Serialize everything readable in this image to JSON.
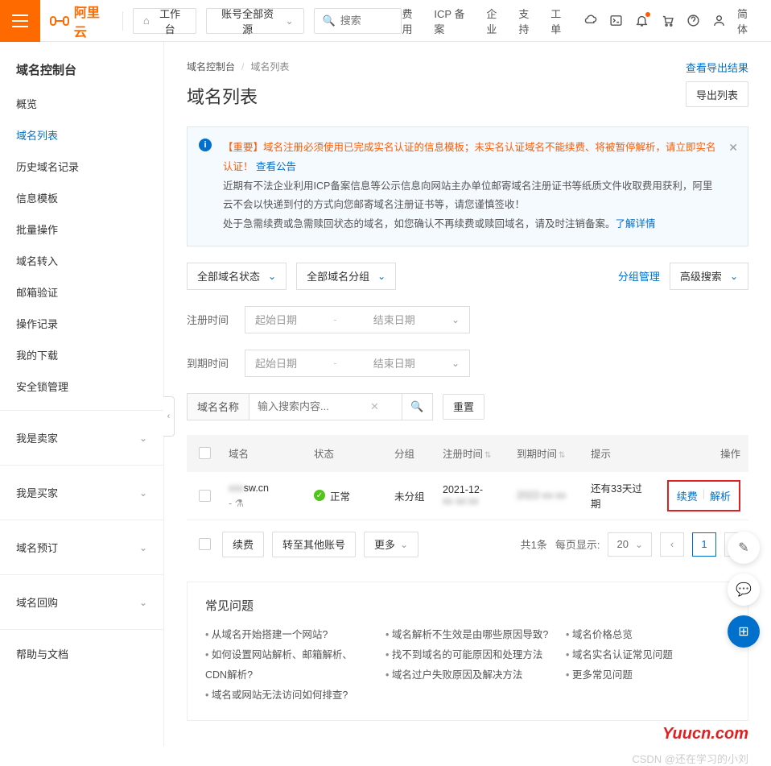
{
  "header": {
    "logo": "阿里云",
    "workspace": "工作台",
    "account_dropdown": "账号全部资源",
    "search_placeholder": "搜索",
    "nav": [
      "费用",
      "ICP 备案",
      "企业",
      "支持",
      "工单"
    ],
    "lang": "简体"
  },
  "sidebar": {
    "title": "域名控制台",
    "items": [
      {
        "label": "概览",
        "active": false
      },
      {
        "label": "域名列表",
        "active": true
      },
      {
        "label": "历史域名记录",
        "active": false
      },
      {
        "label": "信息模板",
        "active": false
      },
      {
        "label": "批量操作",
        "active": false
      },
      {
        "label": "域名转入",
        "active": false
      },
      {
        "label": "邮箱验证",
        "active": false
      },
      {
        "label": "操作记录",
        "active": false
      },
      {
        "label": "我的下载",
        "active": false
      },
      {
        "label": "安全锁管理",
        "active": false
      }
    ],
    "groups": [
      "我是卖家",
      "我是买家",
      "域名预订",
      "域名回购"
    ],
    "help": "帮助与文档"
  },
  "breadcrumb": {
    "parent": "域名控制台",
    "current": "域名列表"
  },
  "page": {
    "title": "域名列表",
    "view_export": "查看导出结果",
    "export_btn": "导出列表"
  },
  "notice": {
    "important_prefix": "【重要】域名注册必须使用已完成实名认证的信息模板；未实名认证域名不能续费、将被暂停解析，请立即实名认证！",
    "link1": "查看公告",
    "line2": "近期有不法企业利用ICP备案信息等公示信息向网站主办单位邮寄域名注册证书等纸质文件收取费用获利，阿里云不会以快递到付的方式向您邮寄域名注册证书等，请您谨慎签收！",
    "line3_prefix": "处于急需续费或急需赎回状态的域名，如您确认不再续费或赎回域名，请及时注销备案。",
    "link2": "了解详情"
  },
  "filters": {
    "status_select": "全部域名状态",
    "group_select": "全部域名分组",
    "group_manage": "分组管理",
    "advanced_search": "高级搜索",
    "reg_time": "注册时间",
    "exp_time": "到期时间",
    "date_start": "起始日期",
    "date_end": "结束日期",
    "search_label": "域名名称",
    "search_placeholder": "输入搜索内容...",
    "reset_btn": "重置"
  },
  "table": {
    "columns": {
      "domain": "域名",
      "status": "状态",
      "group": "分组",
      "reg_time": "注册时间",
      "exp_time": "到期时间",
      "tip": "提示",
      "ops": "操作"
    },
    "rows": [
      {
        "domain_suffix": "sw.cn",
        "domain_line2": "- ⚗",
        "status": "正常",
        "group": "未分组",
        "reg_time": "2021-12-",
        "exp_time": "",
        "tip": "还有33天过期",
        "op_renew": "续费",
        "op_resolve": "解析"
      }
    ],
    "footer": {
      "renew_btn": "续费",
      "transfer_btn": "转至其他账号",
      "more_btn": "更多",
      "total": "共1条",
      "per_page_label": "每页显示:",
      "per_page": "20",
      "current_page": "1"
    }
  },
  "faq": {
    "title": "常见问题",
    "col1": [
      "从域名开始搭建一个网站?",
      "如何设置网站解析、邮箱解析、CDN解析?",
      "域名或网站无法访问如何排查?"
    ],
    "col2": [
      "域名解析不生效是由哪些原因导致?",
      "找不到域名的可能原因和处理方法",
      "域名过户失败原因及解决方法"
    ],
    "col3": [
      "域名价格总览",
      "域名实名认证常见问题",
      "更多常见问题"
    ]
  },
  "watermark": "Yuucn.com",
  "csdn_watermark": "CSDN @还在学习的小刘"
}
